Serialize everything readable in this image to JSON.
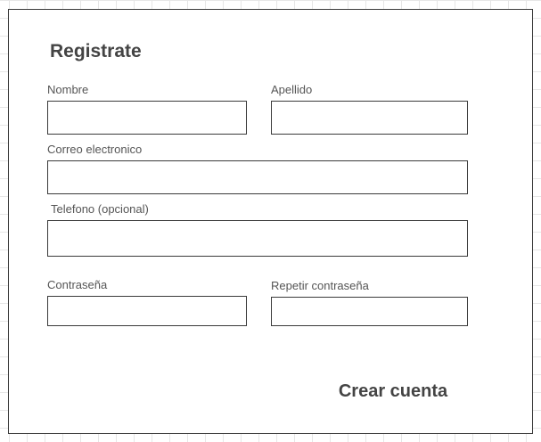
{
  "form": {
    "title": "Registrate",
    "fields": {
      "first_name": {
        "label": "Nombre",
        "value": "",
        "placeholder": ""
      },
      "last_name": {
        "label": "Apellido",
        "value": "",
        "placeholder": ""
      },
      "email": {
        "label": "Correo electronico",
        "value": "",
        "placeholder": ""
      },
      "phone": {
        "label": "Telefono (opcional)",
        "value": "",
        "placeholder": ""
      },
      "password": {
        "label": "Contraseña",
        "value": "",
        "placeholder": ""
      },
      "password_repeat": {
        "label": "Repetir contraseña",
        "value": "",
        "placeholder": ""
      }
    },
    "submit_label": "Crear cuenta"
  }
}
